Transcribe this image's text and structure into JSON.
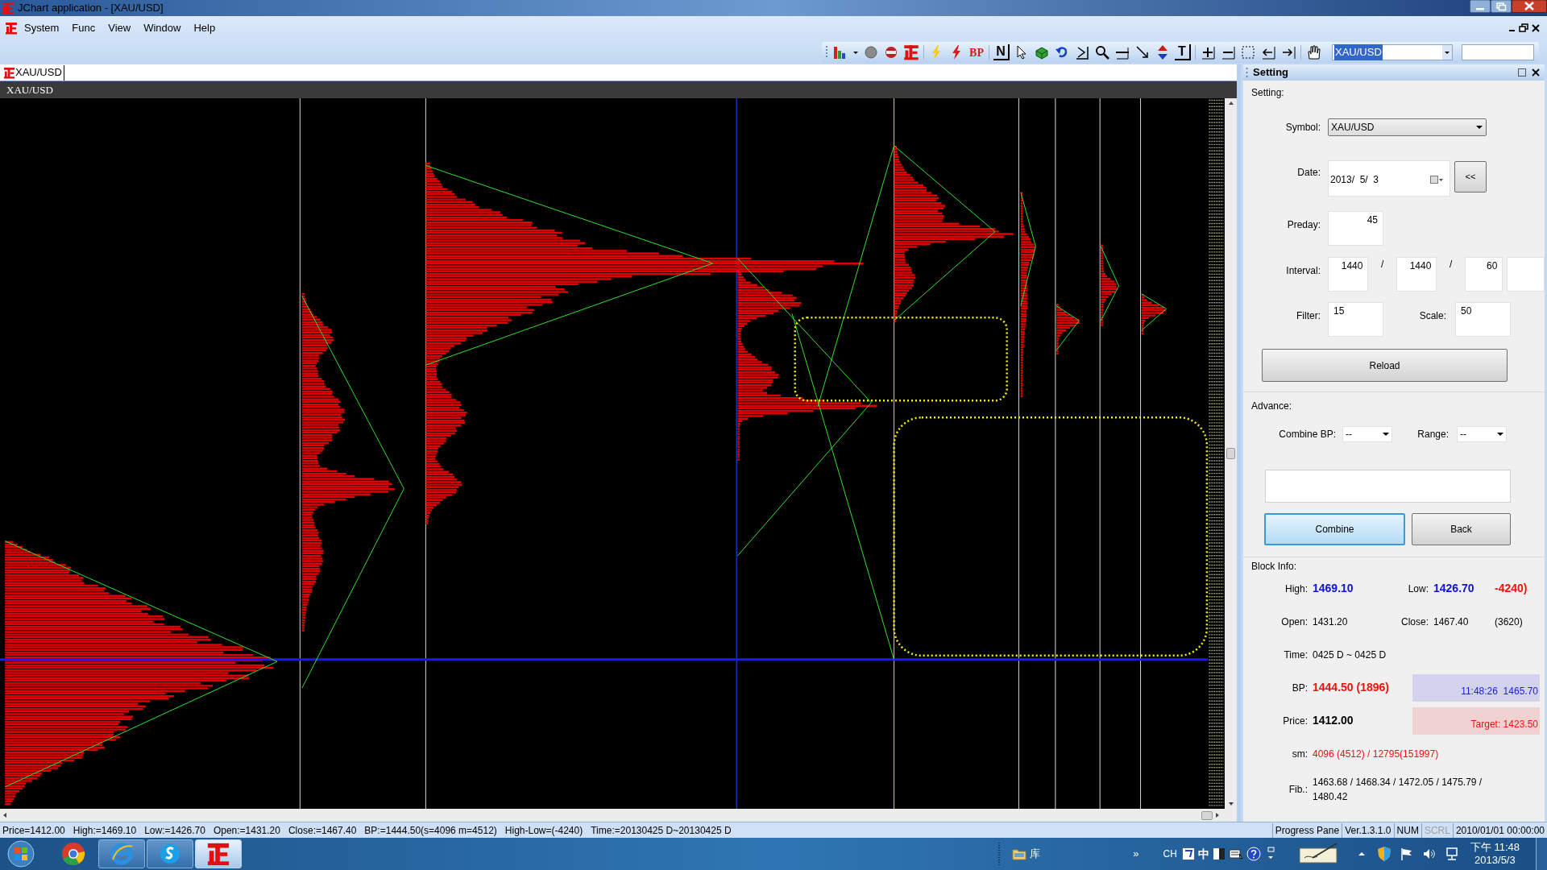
{
  "window": {
    "title": "JChart application - [XAU/USD]"
  },
  "menu": [
    "System",
    "Func",
    "View",
    "Window",
    "Help"
  ],
  "toolbar": {
    "bp_label": "BP",
    "n_label": "N",
    "t_label": "T",
    "symbol": "XAU/USD",
    "symbol_selected": true
  },
  "document_tab": {
    "title": "XAU/USD"
  },
  "chart": {
    "title": "XAU/USD"
  },
  "setting_panel": {
    "title": "Setting",
    "setting": {
      "heading": "Setting:",
      "symbol": {
        "label": "Symbol:",
        "value": "XAU/USD"
      },
      "date": {
        "label": "Date:",
        "value": "2013/  5/  3",
        "back_button": "<<"
      },
      "preday": {
        "label": "Preday:",
        "value": "45"
      },
      "interval": {
        "label": "Interval:",
        "values": [
          "1440",
          "1440",
          "60"
        ],
        "separators": [
          "/",
          "/"
        ]
      },
      "filter": {
        "label": "Filter:",
        "value": "15"
      },
      "scale": {
        "label": "Scale:",
        "value": "50"
      },
      "reload_button": "Reload"
    },
    "advance": {
      "heading": "Advance:",
      "combine_bp": {
        "label": "Combine BP:",
        "value": "--"
      },
      "range": {
        "label": "Range:",
        "value": "--"
      },
      "combine_button": {
        "label": "Combine",
        "focused": true
      },
      "back_button": {
        "label": "Back",
        "focused": false
      }
    },
    "block_info": {
      "heading": "Block Info:",
      "rows": [
        {
          "cells": [
            {
              "kind": "label",
              "text": "High:"
            },
            {
              "kind": "value",
              "text": "1469.10",
              "color": "#1010e0",
              "bold": true
            },
            {
              "kind": "label",
              "text": "Low:"
            },
            {
              "kind": "value",
              "text": "1426.70",
              "color": "#1010e0",
              "bold": true
            },
            {
              "kind": "value",
              "text": "-4240)",
              "color": "#f01010",
              "bold": true
            }
          ]
        },
        {
          "cells": [
            {
              "kind": "label",
              "text": "Open:"
            },
            {
              "kind": "value",
              "text": "1431.20",
              "color": "#000000",
              "bold": false
            },
            {
              "kind": "label",
              "text": "Close:"
            },
            {
              "kind": "value",
              "text": "1467.40",
              "color": "#000000",
              "bold": false
            },
            {
              "kind": "value",
              "text": "(3620)",
              "color": "#000000",
              "bold": false
            }
          ]
        },
        {
          "cells": [
            {
              "kind": "label",
              "text": "Time:"
            },
            {
              "kind": "wide",
              "text": "0425 D ~ 0425 D",
              "color": "#000000",
              "bold": false
            }
          ]
        },
        {
          "cells": [
            {
              "kind": "label",
              "text": "BP:"
            },
            {
              "kind": "value",
              "text": "1444.50 (1896)",
              "color": "#f01010",
              "bold": true
            },
            {
              "kind": "box",
              "text": "11:48:26  1465.70",
              "color": "#1a1ae0",
              "bold": false
            }
          ]
        },
        {
          "cells": [
            {
              "kind": "label",
              "text": "Price:"
            },
            {
              "kind": "value",
              "text": "1412.00",
              "color": "#000000",
              "bold": true
            },
            {
              "kind": "box",
              "text": "Target: 1423.50",
              "color": "#f01010",
              "bold": false
            }
          ]
        },
        {
          "cells": [
            {
              "kind": "label",
              "text": "sm:"
            },
            {
              "kind": "wide",
              "text": "4096 (4512) / 12795(151997)",
              "color": "#f01010",
              "bold": false
            }
          ]
        },
        {
          "cells": [
            {
              "kind": "label",
              "text": "Fib.:"
            },
            {
              "kind": "wide",
              "text": "1463.68 / 1468.34 / 1472.05 / 1475.79 / 1480.42",
              "color": "#000000",
              "bold": false
            }
          ]
        }
      ]
    }
  },
  "status_bar": {
    "info": [
      "Price=1412.00",
      "High:=1469.10",
      "Low:=1426.70",
      "Open:=1431.20",
      "Close:=1467.40",
      "BP:=1444.50(s=4096 m=4512)",
      "High-Low=(-4240)",
      "Time:=20130425 D~20130425 D"
    ],
    "panes": [
      {
        "text": "Progress Pane",
        "disabled": false
      },
      {
        "text": "Ver.1.3.1.0",
        "disabled": false
      },
      {
        "text": "NUM",
        "disabled": false
      },
      {
        "text": "SCRL",
        "disabled": true
      },
      {
        "text": "2010/01/01 00:00:00",
        "disabled": false
      }
    ]
  },
  "taskbar": {
    "folder_label": "库",
    "overflow": "»",
    "input_lang": "CH",
    "ime_mode": "中",
    "time": "下午 11:48",
    "date": "2013/5/3"
  }
}
